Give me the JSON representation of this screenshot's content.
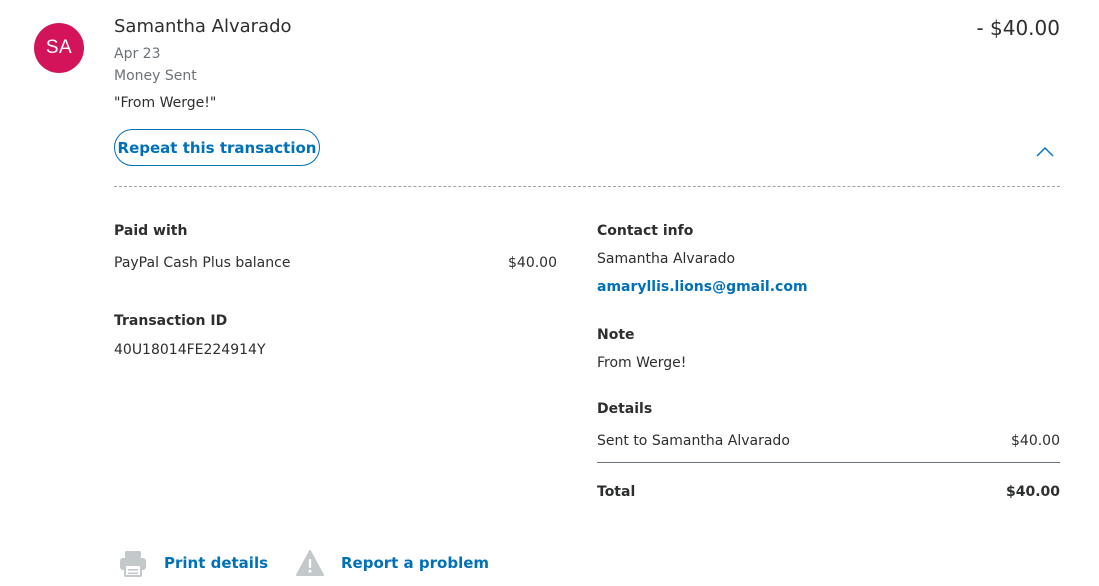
{
  "transaction": {
    "avatar_initials": "SA",
    "name": "Samantha Alvarado",
    "amount": "- $40.00",
    "date": "Apr 23",
    "type": "Money Sent",
    "memo": "\"From Werge!\"",
    "repeat_label": "Repeat this transaction",
    "collapse_icon": "chevron-up-icon"
  },
  "paid_with": {
    "heading": "Paid with",
    "method": "PayPal Cash Plus balance",
    "amount": "$40.00"
  },
  "transaction_id": {
    "heading": "Transaction ID",
    "value": "40U18014FE224914Y"
  },
  "contact": {
    "heading": "Contact info",
    "name": "Samantha Alvarado",
    "email": "amaryllis.lions@gmail.com"
  },
  "note": {
    "heading": "Note",
    "text": "From Werge!"
  },
  "details": {
    "heading": "Details",
    "line_label": "Sent to Samantha Alvarado",
    "line_amount": "$40.00",
    "total_label": "Total",
    "total_amount": "$40.00"
  },
  "actions": {
    "print_label": "Print details",
    "print_icon": "printer-icon",
    "report_label": "Report a problem",
    "report_icon": "warning-icon"
  },
  "colors": {
    "avatar_bg": "#d4145a",
    "link": "#0070ba",
    "text": "#2c2e2f",
    "muted": "#6c7378",
    "icon_gray": "#c3c8cb"
  }
}
